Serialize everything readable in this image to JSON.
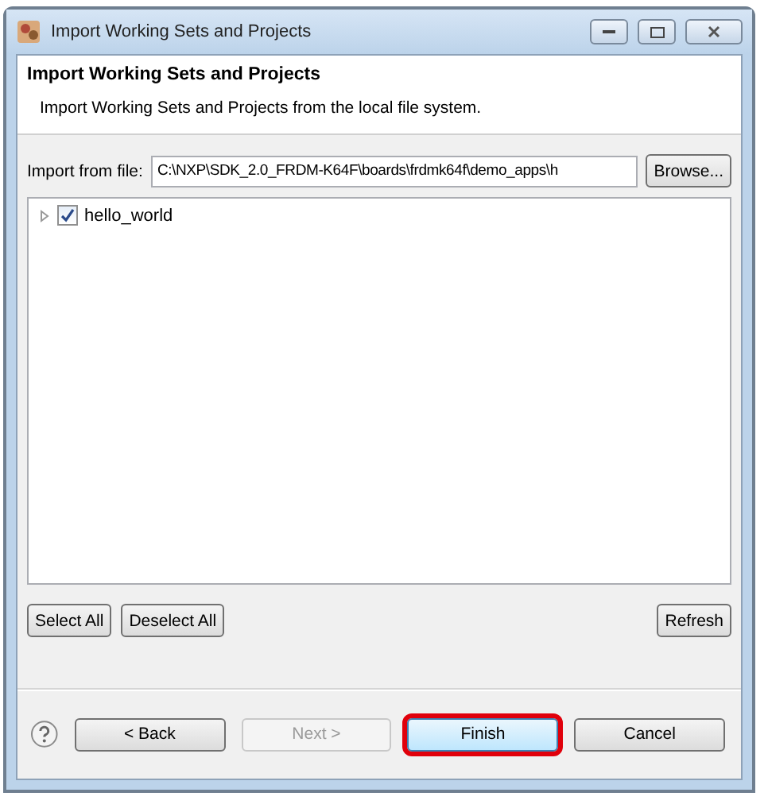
{
  "window": {
    "title": "Import Working Sets and Projects"
  },
  "header": {
    "title": "Import Working Sets and Projects",
    "description": "Import Working Sets and Projects from the local file system."
  },
  "import_from": {
    "label": "Import from file:",
    "value": "C:\\NXP\\SDK_2.0_FRDM-K64F\\boards\\frdmk64f\\demo_apps\\h",
    "button": "Browse..."
  },
  "tree": [
    {
      "label": "hello_world",
      "checked": true,
      "expanded": false
    }
  ],
  "tree_buttons": [
    "Select All",
    "Deselect All",
    "Refresh"
  ],
  "footer_buttons": [
    {
      "label": "< Back",
      "disabled": false,
      "highlighted": false
    },
    {
      "label": "Next >",
      "disabled": true,
      "highlighted": false
    },
    {
      "label": "Finish",
      "disabled": false,
      "highlighted": true
    },
    {
      "label": "Cancel",
      "disabled": false,
      "highlighted": false
    }
  ]
}
